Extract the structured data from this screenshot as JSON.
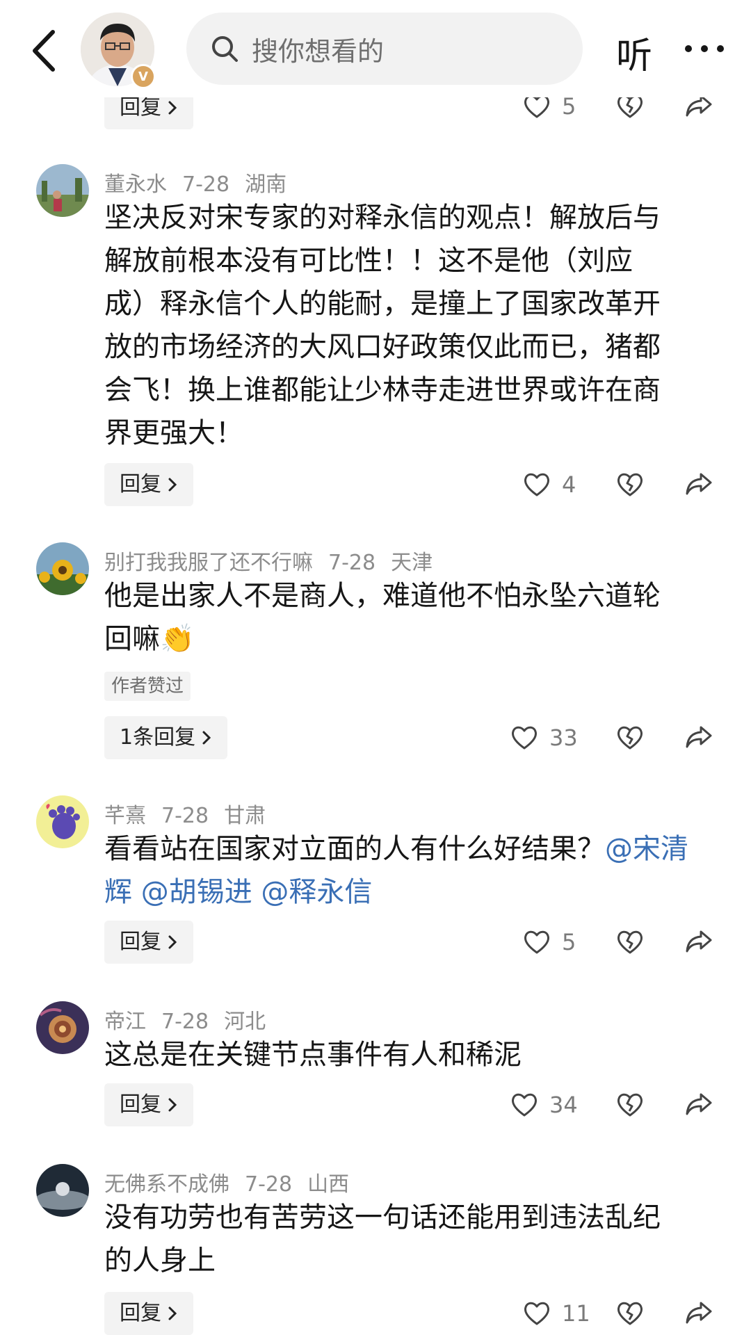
{
  "header": {
    "search_placeholder": "搜你想看的",
    "listen_label": "听",
    "author_badge": "V"
  },
  "reply_label_default": "回复",
  "comments": [
    {
      "id": "prev",
      "reply_label": "回复",
      "like_count": "5"
    },
    {
      "id": "c1",
      "username": "董永水",
      "date": "7-28",
      "location": "湖南",
      "lines": [
        "坚决反对宋专家的对释永信的观点！解放后与",
        "解放前根本没有可比性！！这不是他（刘应",
        "成）释永信个人的能耐，是撞上了国家改革开",
        "放的市场经济的大风口好政策仅此而已，猪都",
        "会飞！换上谁都能让少林寺走进世界或许在商",
        "界更强大！"
      ],
      "reply_label": "回复",
      "like_count": "4"
    },
    {
      "id": "c2",
      "username": "别打我我服了还不行嘛",
      "date": "7-28",
      "location": "天津",
      "lines": [
        "他是出家人不是商人，难道他不怕永坠六道轮",
        "回嘛"
      ],
      "emoji": "👏",
      "author_liked": "作者赞过",
      "reply_label": "1条回复",
      "like_count": "33"
    },
    {
      "id": "c3",
      "username": "芊熹",
      "date": "7-28",
      "location": "甘肃",
      "line1_text": "看看站在国家对立面的人有什么好结果？",
      "line1_mention": "@宋清",
      "line2_mentions": "辉 @胡锡进 @释永信",
      "reply_label": "回复",
      "like_count": "5"
    },
    {
      "id": "c4",
      "username": "帝江",
      "date": "7-28",
      "location": "河北",
      "lines": [
        "这总是在关键节点事件有人和稀泥"
      ],
      "reply_label": "回复",
      "like_count": "34"
    },
    {
      "id": "c5",
      "username": "无佛系不成佛",
      "date": "7-28",
      "location": "山西",
      "lines": [
        "没有功劳也有苦劳这一句话还能用到违法乱纪",
        "的人身上"
      ],
      "reply_label": "回复",
      "like_count": "11"
    }
  ]
}
